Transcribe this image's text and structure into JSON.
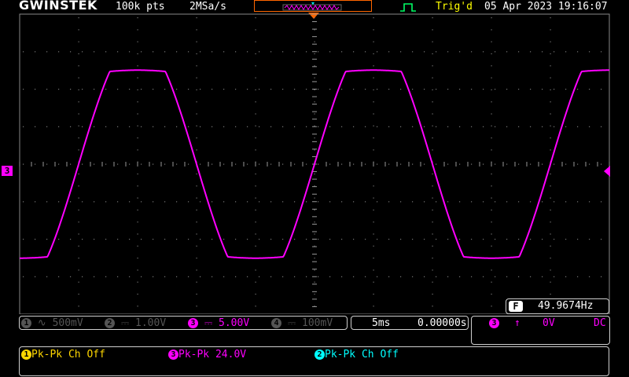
{
  "header": {
    "brand": "GWINSTEK",
    "record_length": "100k pts",
    "sample_rate": "2MSa/s",
    "trigger_status": "Trig'd",
    "datetime": "05 Apr 2023 19:16:07"
  },
  "channel_bar": {
    "ch1": {
      "num": "1",
      "coupling_icon": "ac-coupling-icon",
      "scale": "500mV",
      "color": "#555555"
    },
    "ch2": {
      "num": "2",
      "coupling_icon": "dc-coupling-icon",
      "scale": "1.00V",
      "color": "#555555"
    },
    "ch3": {
      "num": "3",
      "coupling_icon": "dc-coupling-icon",
      "scale": "5.00V",
      "color": "#ff00ff"
    },
    "ch4": {
      "num": "4",
      "coupling_icon": "dc-coupling-icon",
      "scale": "100mV",
      "color": "#555555"
    }
  },
  "timebase": {
    "scale": "5ms",
    "position": "0.00000s"
  },
  "trigger": {
    "source": "3",
    "slope_icon": "rising-edge-icon",
    "level": "0V",
    "coupling": "DC"
  },
  "frequency": {
    "label": "F",
    "value": "49.9674Hz"
  },
  "measurements": [
    {
      "num": "1",
      "text": "Pk-Pk Ch Off",
      "color": "#ffd700"
    },
    {
      "num": "3",
      "text": "Pk-Pk 24.0V",
      "color": "#ff00ff"
    },
    {
      "num": "2",
      "text": "Pk-Pk Ch Off",
      "color": "#00ffff"
    }
  ],
  "channel_marker": "3",
  "colors": {
    "ch1": "#ffd700",
    "ch2": "#00ffff",
    "ch3": "#ff00ff",
    "trigger": "#ff6600",
    "grid": "#777777"
  }
}
